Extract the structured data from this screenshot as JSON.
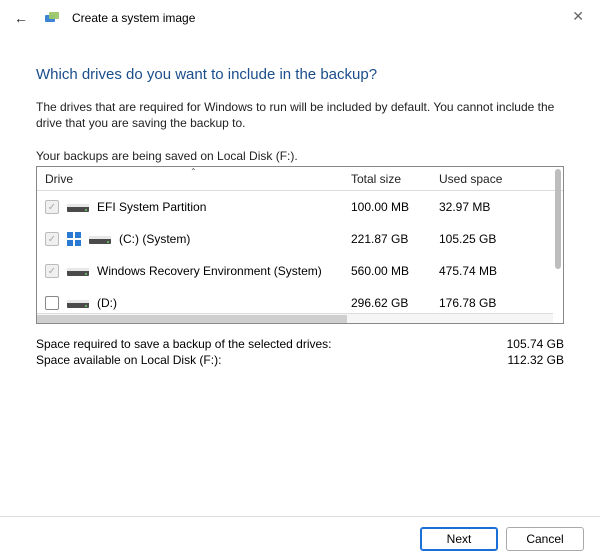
{
  "window": {
    "title": "Create a system image"
  },
  "page": {
    "heading": "Which drives do you want to include in the backup?",
    "description": "The drives that are required for Windows to run will be included by default. You cannot include the drive that you are saving the backup to.",
    "saved_on": "Your backups are being saved on Local Disk (F:)."
  },
  "table": {
    "columns": {
      "drive": "Drive",
      "total": "Total size",
      "used": "Used space"
    },
    "rows": [
      {
        "label": "EFI System Partition",
        "total": "100.00 MB",
        "used": "32.97 MB",
        "locked": true,
        "logo": false
      },
      {
        "label": "(C:) (System)",
        "total": "221.87 GB",
        "used": "105.25 GB",
        "locked": true,
        "logo": true
      },
      {
        "label": "Windows Recovery Environment (System)",
        "total": "560.00 MB",
        "used": "475.74 MB",
        "locked": true,
        "logo": false
      },
      {
        "label": "(D:)",
        "total": "296.62 GB",
        "used": "176.78 GB",
        "locked": false,
        "logo": false
      }
    ]
  },
  "summary": {
    "required_label": "Space required to save a backup of the selected drives:",
    "required_value": "105.74 GB",
    "available_label": "Space available on Local Disk (F:):",
    "available_value": "112.32 GB"
  },
  "buttons": {
    "next": "Next",
    "cancel": "Cancel"
  }
}
